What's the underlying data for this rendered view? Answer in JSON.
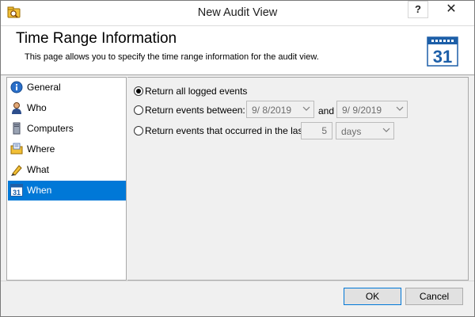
{
  "window": {
    "title": "New Audit View",
    "help_label": "?",
    "close_label": "✕"
  },
  "header": {
    "title": "Time Range Information",
    "description": "This page allows you to specify the time range information for the audit view.",
    "calendar_number": "31"
  },
  "nav": {
    "items": [
      {
        "label": "General",
        "icon": "info-icon"
      },
      {
        "label": "Who",
        "icon": "user-icon"
      },
      {
        "label": "Computers",
        "icon": "computer-icon"
      },
      {
        "label": "Where",
        "icon": "folder-icon"
      },
      {
        "label": "What",
        "icon": "pencil-icon"
      },
      {
        "label": "When",
        "icon": "calendar-icon",
        "selected": true
      }
    ]
  },
  "content": {
    "option_all": "Return all logged events",
    "option_between": "Return events between:",
    "option_last": "Return events that occurred in the last",
    "start_date": "9/  8/2019",
    "and_label": "and",
    "end_date": "9/  9/2019",
    "last_count": "5",
    "last_unit": "days",
    "selected_option": "all"
  },
  "footer": {
    "ok_label": "OK",
    "cancel_label": "Cancel"
  },
  "colors": {
    "accent": "#0078d7",
    "dialog_bg": "#f0f0f0"
  }
}
